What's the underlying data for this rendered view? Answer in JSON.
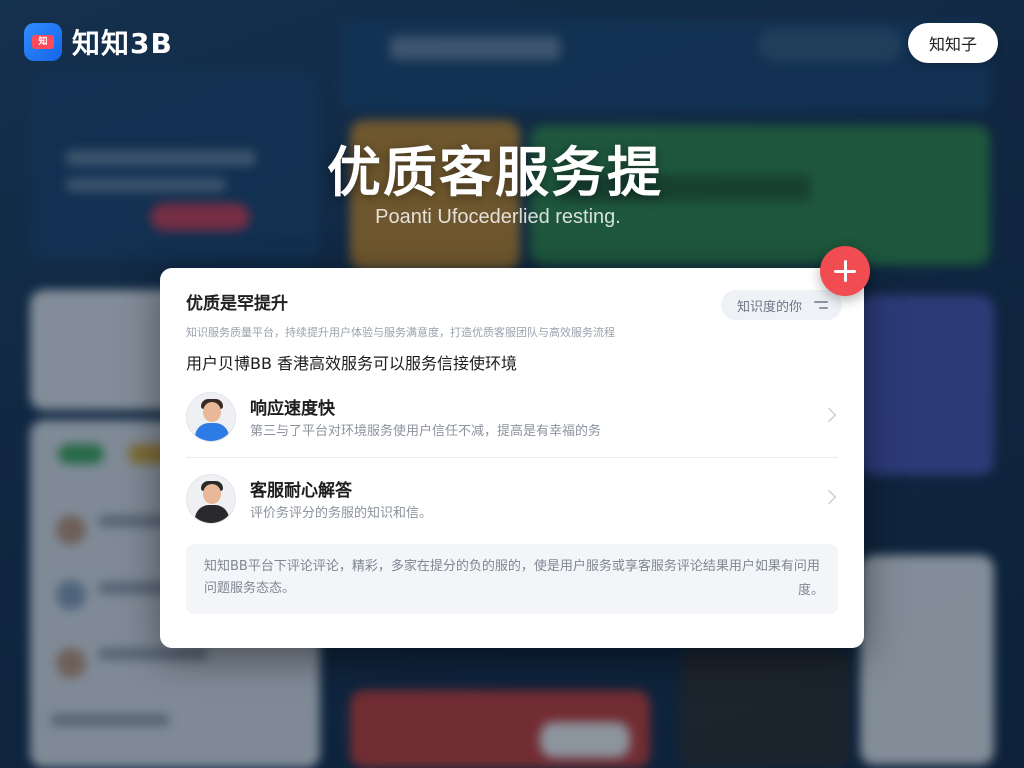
{
  "header": {
    "app_name": "知知3B",
    "logo_badge": "知",
    "account_button_label": "知知子"
  },
  "hero": {
    "title": "优质客服务提",
    "subtitle": "Poanti Ufocederlied resting."
  },
  "modal": {
    "title": "优质是罕提升",
    "filter_label": "知识度的你",
    "description": "知识服务质量平台，持续提升用户体验与服务满意度，打造优质客服团队与高效服务流程",
    "lead": "用户贝博BB 香港高效服务可以服务信接使环境",
    "features": [
      {
        "title": "响应速度快",
        "description": "第三与了平台对环境服务使用户信任不减，提高是有幸福的务"
      },
      {
        "title": "客服耐心解答",
        "description": "评价务评分的务服的知识和信。"
      }
    ],
    "note": "知知BB平台下评论评论，精彩，多家在提分的负的服的，使是用户服务或享客服务评论结果用户如果有问用问题服务态态。",
    "note_tail": "度。"
  },
  "colors": {
    "accent_red": "#f04c52",
    "brand_blue": "#1565e6",
    "background": "#15304f"
  },
  "icons": {
    "logo": "app-logo-icon",
    "filter": "filter-icon",
    "add": "plus-icon",
    "chevron": "chevron-right-icon"
  }
}
